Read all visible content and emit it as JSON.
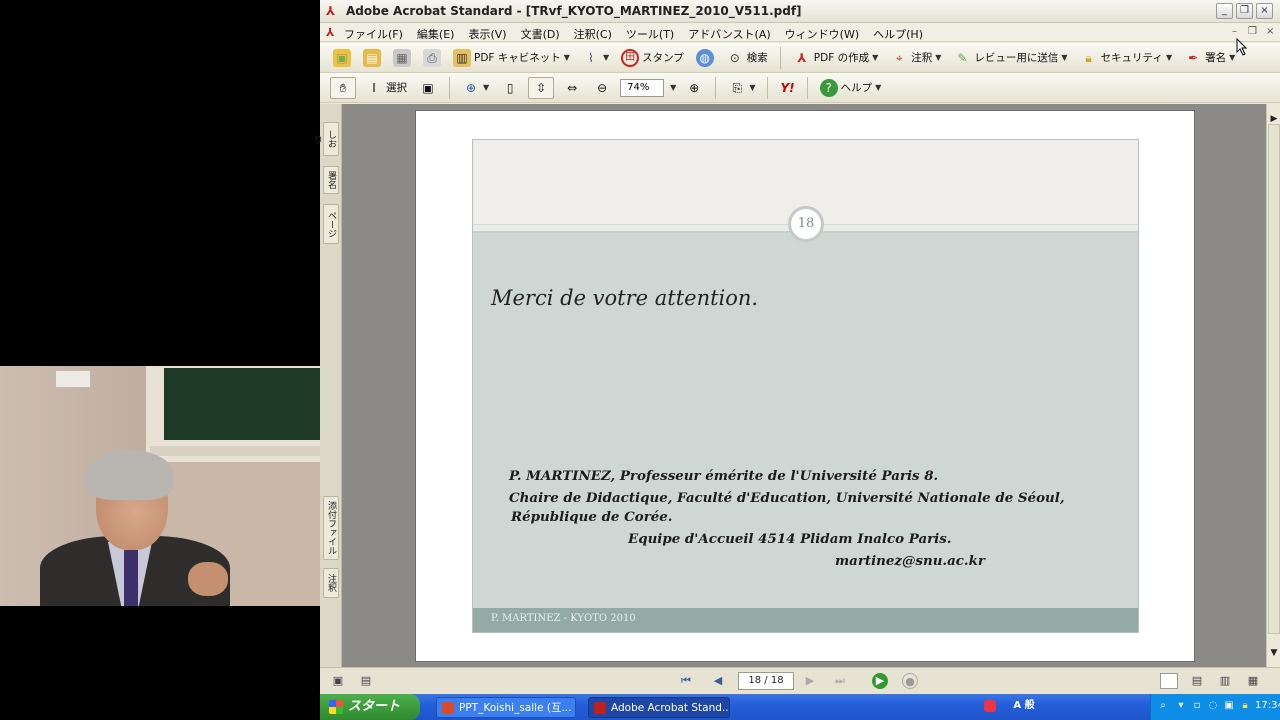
{
  "window": {
    "title": "Adobe Acrobat Standard - [TRvf_KYOTO_MARTINEZ_2010_V511.pdf]",
    "minimize_label": "_",
    "restore_label": "❐",
    "close_label": "×"
  },
  "menubar": {
    "items": [
      "ファイル(F)",
      "編集(E)",
      "表示(V)",
      "文書(D)",
      "注釈(C)",
      "ツール(T)",
      "アドバンスト(A)",
      "ウィンドウ(W)",
      "ヘルプ(H)"
    ]
  },
  "toolbar1": {
    "pdf_cabinet": "PDF キャビネット",
    "stamp": "スタンプ",
    "search": "検索",
    "create_pdf": "PDF の作成",
    "comment": "注釈",
    "send_review": "レビュー用に送信",
    "security": "セキュリティ",
    "sign": "署名"
  },
  "toolbar2": {
    "select": "選択",
    "zoom_value": "74%",
    "yahoo": "Y!",
    "help": "ヘルプ"
  },
  "navpanel": {
    "tabs": [
      "しおり",
      "署名",
      "ページ",
      "添付ファイル",
      "注釈"
    ]
  },
  "slide": {
    "number": "18",
    "title": "Merci de votre attention.",
    "lines": [
      "P. MARTINEZ, Professeur émérite de l'Université Paris 8.",
      "Chaire de Didactique, Faculté d'Education, Université Nationale de Séoul,",
      "République de Corée.",
      "Equipe d'Accueil 4514 Plidam Inalco Paris.",
      "martinez@snu.ac.kr"
    ],
    "footer": "P. MARTINEZ - KYOTO 2010"
  },
  "statusbar": {
    "page_counter": "18 / 18"
  },
  "taskbar": {
    "start_label": "スタート",
    "tasks": [
      "PPT_Koishi_salle (互...",
      "Adobe Acrobat Stand..."
    ],
    "ime_label": "A 般",
    "clock": "17:34"
  },
  "colors": {
    "slide_background": "#cfd7d5",
    "slide_footer": "#93aba4",
    "taskbar": "#245edb",
    "start_button": "#2e8b2e"
  },
  "icons": [
    "pdf-icon",
    "open-icon",
    "save-icon",
    "print-icon",
    "hand-tool-icon",
    "zoom-icon",
    "play-icon",
    "stop-icon"
  ]
}
